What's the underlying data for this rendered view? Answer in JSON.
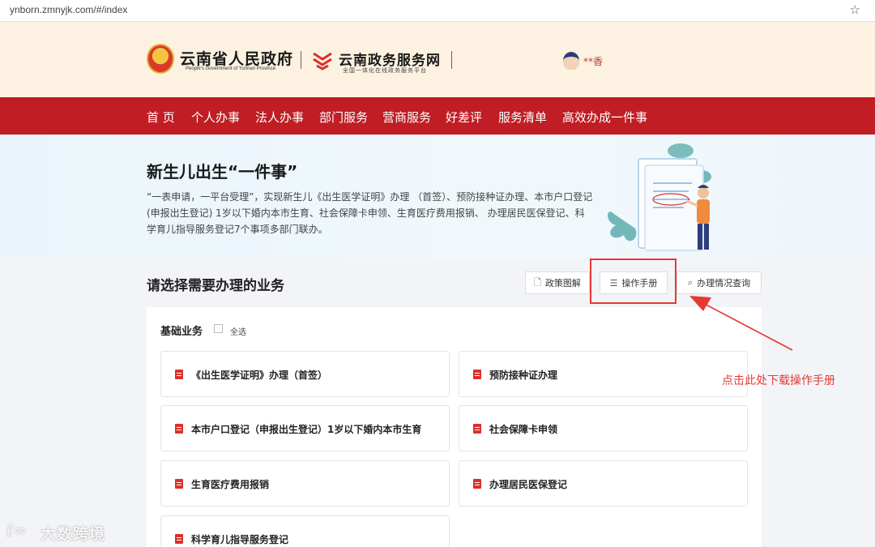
{
  "browser": {
    "url": "ynborn.zmnyjk.com/#/index"
  },
  "header": {
    "gov_name": "云南省人民政府",
    "gov_name_en": "People's Government of Yunnan Province",
    "service_name": "云南政务服务网",
    "service_sub": "全国一体化在线政务服务平台",
    "username": "**香"
  },
  "nav": {
    "items": [
      "首 页",
      "个人办事",
      "法人办事",
      "部门服务",
      "营商服务",
      "好差评",
      "服务清单",
      "高效办成一件事"
    ]
  },
  "banner": {
    "title": "新生儿出生“一件事”",
    "desc": "“一表申请，一平台受理”，实现新生儿《出生医学证明》办理 （首签）、预防接种证办理、本市户口登记(申报出生登记) 1岁以下婚内本市生育、社会保障卡申领、生育医疗费用报销、 办理居民医保登记、科学育儿指导服务登记7个事项多部门联办。"
  },
  "section": {
    "title": "请选择需要办理的业务",
    "buttons": {
      "policy": "政策图解",
      "manual": "操作手册",
      "query": "办理情况查询"
    }
  },
  "group": {
    "title": "基础业务",
    "select_all": "全选",
    "items": [
      "《出生医学证明》办理（首签）",
      "预防接种证办理",
      "本市户口登记（申报出生登记）1岁以下婚内本市生育",
      "社会保障卡申领",
      "生育医疗费用报销",
      "办理居民医保登记",
      "科学育儿指导服务登记"
    ]
  },
  "annotation": "点击此处下载操作手册",
  "watermark": "大数跨境",
  "colors": {
    "nav_red": "#c01d24",
    "annotation_red": "#e53935",
    "header_bg": "#fdf1e1"
  }
}
